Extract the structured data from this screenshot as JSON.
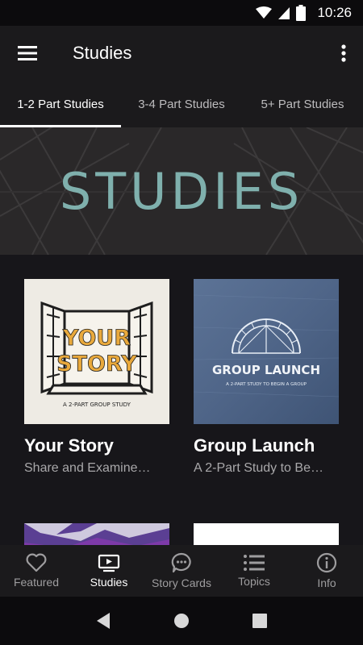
{
  "status_bar": {
    "time": "10:26"
  },
  "app_bar": {
    "title": "Studies"
  },
  "tabs": [
    {
      "label": "1-2 Part Studies",
      "active": true
    },
    {
      "label": "3-4 Part Studies",
      "active": false
    },
    {
      "label": "5+ Part Studies",
      "active": false
    }
  ],
  "banner": {
    "title": "STUDIES"
  },
  "cards": [
    {
      "title": "Your Story",
      "subtitle": "Share and Examine…",
      "art_text": "YOUR STORY",
      "art_caption": "A 2-PART GROUP STUDY"
    },
    {
      "title": "Group Launch",
      "subtitle": "A 2-Part Study to Be…",
      "art_text": "GROUP LAUNCH",
      "art_caption": "A 2-PART STUDY TO BEGIN A GROUP"
    }
  ],
  "bottom_nav": [
    {
      "label": "Featured",
      "icon": "heart-icon"
    },
    {
      "label": "Studies",
      "icon": "tv-play-icon"
    },
    {
      "label": "Story Cards",
      "icon": "chat-bubble-icon"
    },
    {
      "label": "Topics",
      "icon": "list-icon"
    },
    {
      "label": "Info",
      "icon": "info-icon"
    }
  ],
  "colors": {
    "accent_banner": "#7fb0ad",
    "background": "#17161a",
    "bar": "#1b1a1c"
  }
}
